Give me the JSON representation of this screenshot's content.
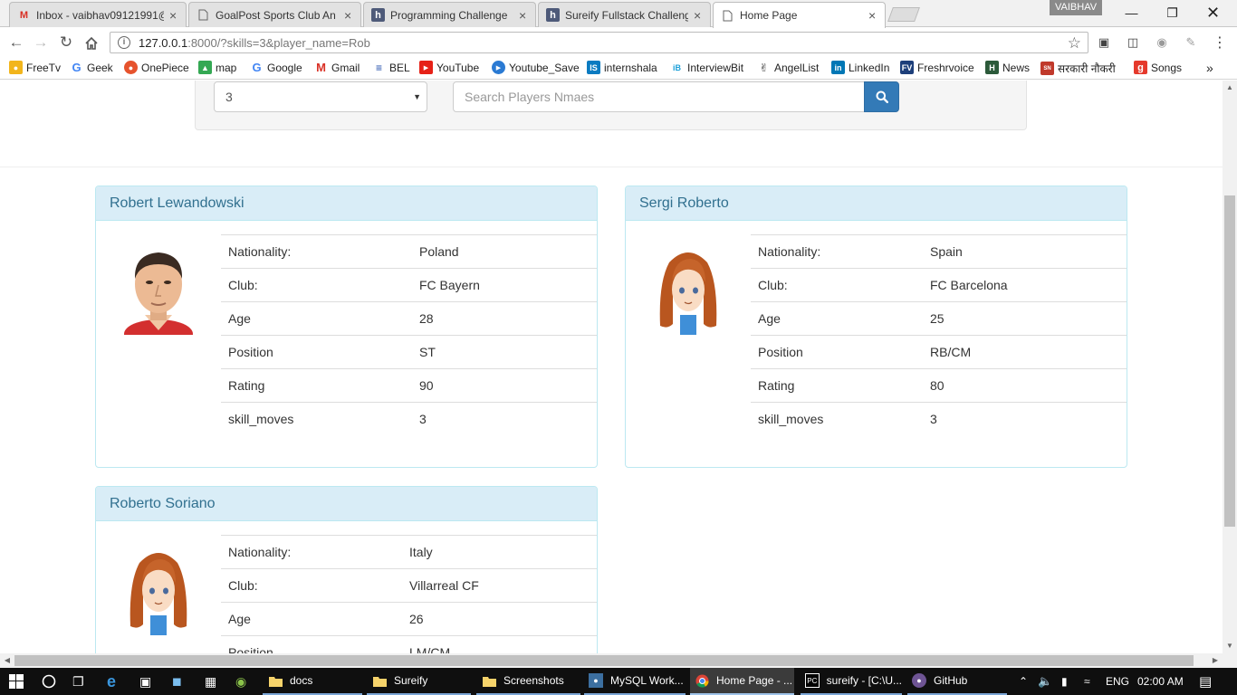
{
  "browser": {
    "tabs": [
      {
        "label": "Inbox - vaibhav09121991@",
        "icon": "gmail-icon"
      },
      {
        "label": "GoalPost Sports Club An",
        "icon": "page-icon"
      },
      {
        "label": "Programming Challenge",
        "icon": "hackerearth-icon"
      },
      {
        "label": "Sureify Fullstack Challeng",
        "icon": "hackerearth-icon"
      },
      {
        "label": "Home Page",
        "icon": "page-icon"
      }
    ],
    "profile_name": "VAIBHAV",
    "url_host": "127.0.0.1",
    "url_rest": ":8000/?skills=3&player_name=Rob",
    "bookmarks": [
      {
        "label": "FreeTv",
        "icon": "freetv-icon",
        "color": "#f2b51c"
      },
      {
        "label": "Geek",
        "icon": "google-icon",
        "color": "#4285f4"
      },
      {
        "label": "OnePiece",
        "icon": "onepiece-icon",
        "color": "#e6532d"
      },
      {
        "label": "map",
        "icon": "maps-icon",
        "color": "#34a853"
      },
      {
        "label": "Google",
        "icon": "google-icon",
        "color": "#4285f4"
      },
      {
        "label": "Gmail",
        "icon": "gmail-icon",
        "color": "#d93025"
      },
      {
        "label": "BEL",
        "icon": "bel-icon",
        "color": "#1b4aa8"
      },
      {
        "label": "YouTube",
        "icon": "youtube-icon",
        "color": "#e62117"
      },
      {
        "label": "Youtube_Save",
        "icon": "save-icon",
        "color": "#2a7ad3"
      },
      {
        "label": "internshala",
        "icon": "internshala-icon",
        "color": "#0b7bc1"
      },
      {
        "label": "InterviewBit",
        "icon": "interviewbit-icon",
        "color": "#1b9fd8"
      },
      {
        "label": "AngelList",
        "icon": "angellist-icon",
        "color": "#333333"
      },
      {
        "label": "LinkedIn",
        "icon": "linkedin-icon",
        "color": "#0077b5"
      },
      {
        "label": "Freshrvoice",
        "icon": "freshrvoice-icon",
        "color": "#1d3f7a"
      },
      {
        "label": "News",
        "icon": "news-icon",
        "color": "#2c5a3a"
      },
      {
        "label": "सरकारी नौकरी",
        "icon": "sarkari-icon",
        "color": "#c0392b"
      },
      {
        "label": "Songs",
        "icon": "songs-icon",
        "color": "#e5392c"
      }
    ]
  },
  "filter": {
    "skills_value": "3",
    "search_placeholder": "Search Players Nmaes"
  },
  "players": [
    {
      "name": "Robert Lewandowski",
      "avatar": "male-photo",
      "fields": [
        {
          "label": "Nationality:",
          "value": "Poland"
        },
        {
          "label": "Club:",
          "value": "FC Bayern"
        },
        {
          "label": "Age",
          "value": "28"
        },
        {
          "label": "Position",
          "value": "ST"
        },
        {
          "label": "Rating",
          "value": "90"
        },
        {
          "label": "skill_moves",
          "value": "3"
        }
      ]
    },
    {
      "name": "Sergi Roberto",
      "avatar": "girl-cartoon",
      "fields": [
        {
          "label": "Nationality:",
          "value": "Spain"
        },
        {
          "label": "Club:",
          "value": "FC Barcelona"
        },
        {
          "label": "Age",
          "value": "25"
        },
        {
          "label": "Position",
          "value": "RB/CM"
        },
        {
          "label": "Rating",
          "value": "80"
        },
        {
          "label": "skill_moves",
          "value": "3"
        }
      ]
    },
    {
      "name": "Roberto Soriano",
      "avatar": "girl-cartoon",
      "fields": [
        {
          "label": "Nationality:",
          "value": "Italy"
        },
        {
          "label": "Club:",
          "value": "Villarreal CF"
        },
        {
          "label": "Age",
          "value": "26"
        },
        {
          "label": "Position",
          "value": "LM/CM"
        }
      ]
    }
  ],
  "taskbar": {
    "apps": [
      {
        "label": "docs",
        "icon": "folder-icon"
      },
      {
        "label": "Sureify",
        "icon": "folder-icon"
      },
      {
        "label": "Screenshots",
        "icon": "folder-icon"
      },
      {
        "label": "MySQL Work...",
        "icon": "mysql-icon"
      },
      {
        "label": "Home Page - ...",
        "icon": "chrome-icon"
      },
      {
        "label": "sureify - [C:\\U...",
        "icon": "pycharm-icon"
      },
      {
        "label": "GitHub",
        "icon": "github-icon"
      }
    ],
    "language": "ENG",
    "time": "02:00 AM"
  },
  "colors": {
    "panel_heading_bg": "#d9edf7",
    "panel_heading_text": "#31708f",
    "search_button": "#337ab7"
  }
}
